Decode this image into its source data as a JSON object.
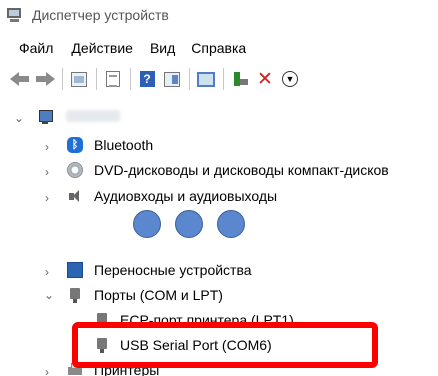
{
  "window": {
    "title": "Диспетчер устройств"
  },
  "menu": [
    "Файл",
    "Действие",
    "Вид",
    "Справка"
  ],
  "toolbar": {
    "icons": [
      "back-icon",
      "forward-icon",
      "properties-icon",
      "update-driver-icon",
      "help-icon",
      "view-icon",
      "scan-icon",
      "add-driver-icon",
      "uninstall-icon",
      "download-icon"
    ]
  },
  "tree": {
    "root_label": "",
    "items": [
      {
        "label": "Bluetooth",
        "icon": "bluetooth-icon"
      },
      {
        "label": "DVD-дисководы и дисководы компакт-дисков",
        "icon": "dvd-icon"
      },
      {
        "label": "Аудиовходы и аудиовыходы",
        "icon": "audio-icon"
      },
      {
        "label": "Переносные устройства",
        "icon": "portable-device-icon"
      },
      {
        "label": "Порты (COM и LPT)",
        "icon": "port-icon"
      },
      {
        "label": "ECP-порт принтера (LPT1)",
        "icon": "port-icon"
      },
      {
        "label": "USB Serial Port (COM6)",
        "icon": "port-icon"
      },
      {
        "label": "Принтеры",
        "icon": "printer-icon"
      }
    ]
  },
  "colors": {
    "highlight": "#ff0000",
    "circles": "#5b87cf"
  }
}
